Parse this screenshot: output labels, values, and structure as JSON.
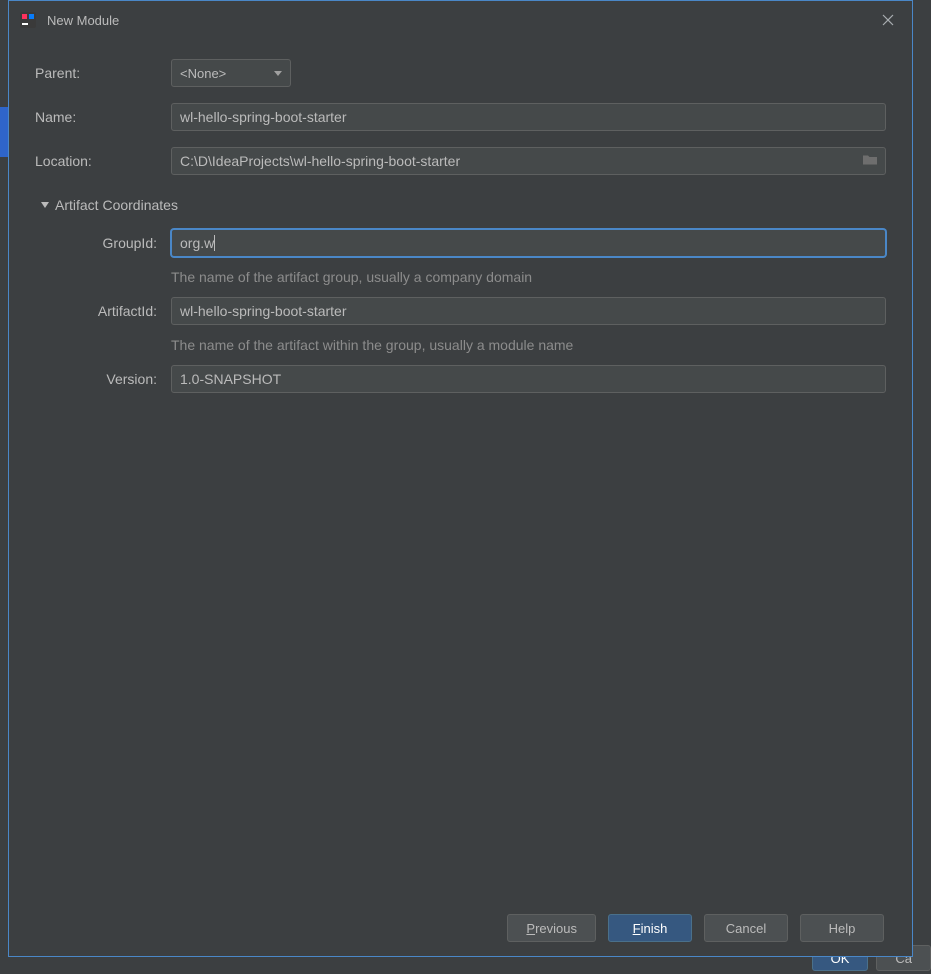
{
  "window": {
    "title": "New Module"
  },
  "form": {
    "parent": {
      "label": "Parent:",
      "value": "<None>"
    },
    "name": {
      "label": "Name:",
      "value": "wl-hello-spring-boot-starter"
    },
    "location": {
      "label": "Location:",
      "value": "C:\\D\\IdeaProjects\\wl-hello-spring-boot-starter"
    }
  },
  "artifact": {
    "header": "Artifact Coordinates",
    "groupId": {
      "label": "GroupId:",
      "value": "org.w",
      "hint": "The name of the artifact group, usually a company domain"
    },
    "artifactId": {
      "label": "ArtifactId:",
      "value": "wl-hello-spring-boot-starter",
      "hint": "The name of the artifact within the group, usually a module name"
    },
    "version": {
      "label": "Version:",
      "value": "1.0-SNAPSHOT"
    }
  },
  "buttons": {
    "previous_prefix": "P",
    "previous_rest": "revious",
    "finish_prefix": "F",
    "finish_rest": "inish",
    "cancel": "Cancel",
    "help": "Help"
  },
  "bg": {
    "ok": "OK",
    "cancel_partial": "Ca"
  }
}
